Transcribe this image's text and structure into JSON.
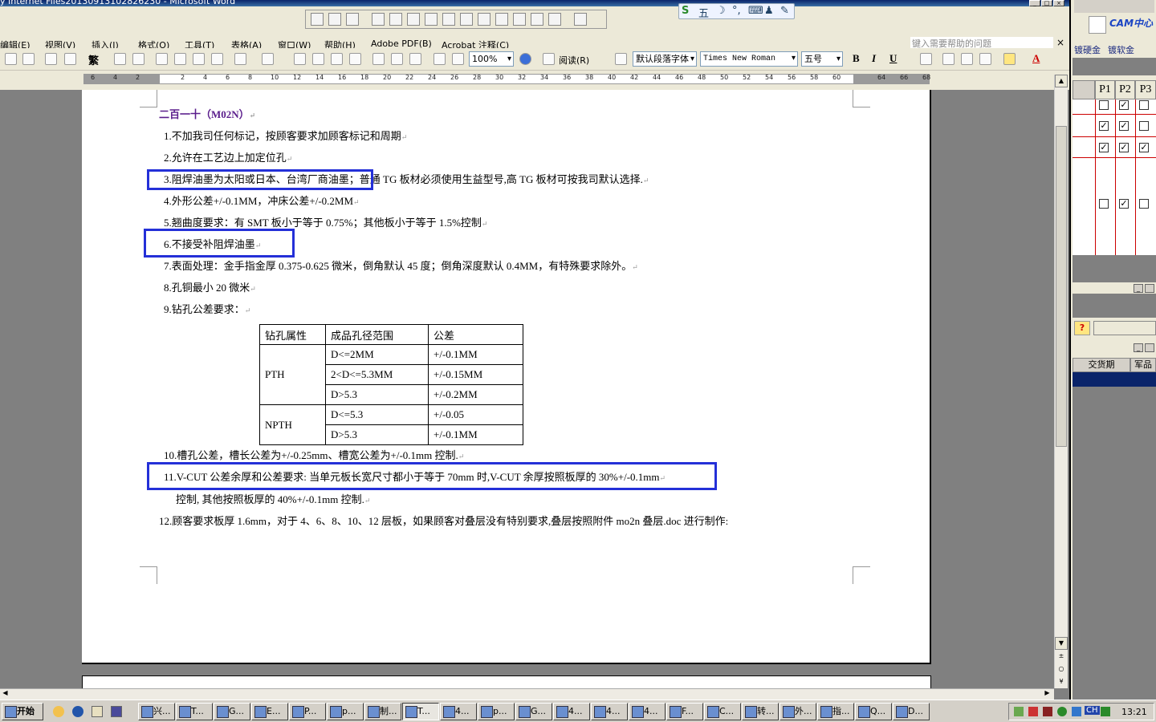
{
  "window": {
    "title": "y Internet Files20130913102826230 - Microsoft Word",
    "min_glyph": "_",
    "max_glyph": "□",
    "close_glyph": "×"
  },
  "menu": {
    "items": [
      "编辑(E)",
      "视图(V)",
      "插入(I)",
      "格式(O)",
      "工具(T)",
      "表格(A)",
      "窗口(W)",
      "帮助(H)",
      "Adobe PDF(B)",
      "Acrobat 注释(C)"
    ],
    "help_placeholder": "键入需要帮助的问题",
    "close_glyph": "×"
  },
  "ime": {
    "glyphs": [
      "S",
      "五",
      "☽",
      "°,",
      "⌨",
      "♟",
      "✎"
    ]
  },
  "toolbar": {
    "traditional": "繁",
    "zoom": "100%",
    "read": "阅读(R)",
    "style": "默认段落字体",
    "font": "Times New Roman",
    "size": "五号",
    "bold": "B",
    "italic": "I",
    "underline": "U",
    "font_color": "A"
  },
  "ruler": {
    "ticks": [
      "6",
      "4",
      "2",
      "2",
      "4",
      "6",
      "8",
      "10",
      "12",
      "14",
      "16",
      "18",
      "20",
      "22",
      "24",
      "26",
      "28",
      "30",
      "32",
      "34",
      "36",
      "38",
      "40",
      "42",
      "44",
      "46",
      "48",
      "50",
      "52",
      "54",
      "56",
      "58",
      "60",
      "64",
      "66",
      "68"
    ]
  },
  "document": {
    "heading": "二百一十（M02N）",
    "lines": [
      "1.不加我司任何标记，按顾客要求加顾客标记和周期",
      "2.允许在工艺边上加定位孔",
      "3.阻焊油墨为太阳或日本、台湾厂商油墨；普通 TG 板材必须使用生益型号,高 TG 板材可按我司默认选择.",
      "4.外形公差+/-0.1MM，冲床公差+/-0.2MM",
      "5.翘曲度要求：有 SMT 板小于等于 0.75%；其他板小于等于 1.5%控制",
      "6.不接受补阻焊油墨",
      "7.表面处理：金手指金厚 0.375-0.625 微米，倒角默认 45 度；倒角深度默认 0.4MM，有特殊要求除外。",
      "8.孔铜最小 20 微米",
      "9.钻孔公差要求："
    ],
    "table": {
      "headers": [
        "钻孔属性",
        "成品孔径范围",
        "公差"
      ],
      "pth_label": "PTH",
      "npth_label": "NPTH",
      "pth_rows": [
        [
          "D<=2MM",
          "+/-0.1MM"
        ],
        [
          "2<D<=5.3MM",
          "+/-0.15MM"
        ],
        [
          "D>5.3",
          "+/-0.2MM"
        ]
      ],
      "npth_rows": [
        [
          "D<=5.3",
          "+/-0.05"
        ],
        [
          "D>5.3",
          "+/-0.1MM"
        ]
      ]
    },
    "line10": "10.槽孔公差，槽长公差为+/-0.25mm、槽宽公差为+/-0.1mm 控制.",
    "line11a": "11.V-CUT 公差余厚和公差要求: 当单元板长宽尺寸都小于等于 70mm 时,V-CUT 余厚按照板厚的 30%+/-0.1mm",
    "line11b": "控制,    其他按照板厚的 40%+/-0.1mm 控制.",
    "line12": "12.顾客要求板厚  1.6mm，对于  4、6、8、10、12  层板，如果顾客对叠层没有特别要求,叠层按照附件  mo2n  叠层.doc  进行制作:"
  },
  "rightpane": {
    "logo": "CAM中心",
    "tabs": [
      "镀硬金",
      "镀软金"
    ],
    "cols": [
      "P1",
      "P2",
      "P3"
    ],
    "rows": [
      [
        false,
        true,
        false
      ],
      [
        true,
        true,
        false
      ],
      [
        true,
        true,
        true
      ],
      [
        false,
        true,
        false
      ]
    ],
    "col2": [
      "交货期",
      "军品"
    ],
    "help_glyph": "?"
  },
  "taskbar": {
    "start": "开始",
    "tasks": [
      "兴...",
      "T...",
      "G...",
      "E...",
      "P...",
      "p...",
      "制...",
      "T...",
      "4...",
      "p...",
      "G...",
      "4...",
      "4...",
      "4...",
      "F...",
      "C...",
      "转...",
      "外...",
      "指...",
      "Q...",
      "D..."
    ],
    "tray_lang": "CH",
    "time": "13:21"
  },
  "colors": {
    "highlight": "#2430d8",
    "heading": "#5a1d8c",
    "title_bar": "#0a246a"
  }
}
